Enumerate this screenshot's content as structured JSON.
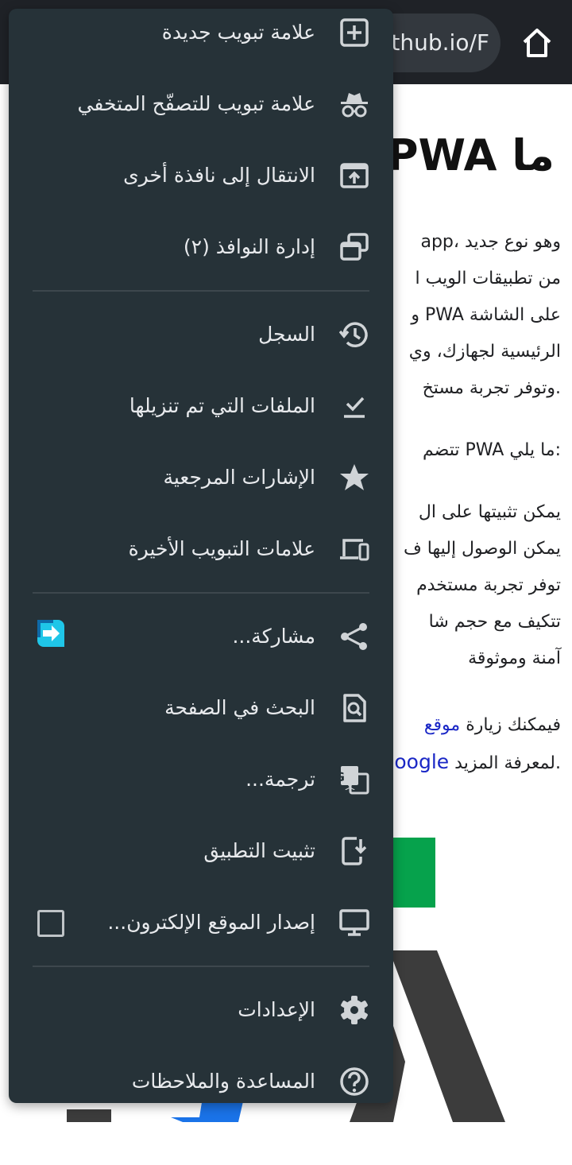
{
  "browser": {
    "url_fragment": "ithub.io/F",
    "home_icon": "home-icon"
  },
  "page": {
    "title": "ما PWA؟",
    "para1": [
      "وهو نوع جديد ،app",
      "من تطبيقات الويب ا",
      "على الشاشة PWA و",
      "الرئيسية لجهازك، وي",
      ".وتوفر تجربة مستخ"
    ],
    "para2": ":ما يلي PWA تتضم",
    "list": [
      "يمكن تثبيتها على ال",
      "يمكن الوصول إليها ف",
      "توفر تجربة مستخدم",
      "تتكيف مع حجم شا",
      "آمنة وموثوقة"
    ],
    "outro_line1_text": "فيمكنك زيارة ",
    "outro_line1_link": "موقع",
    "outro_line2_text": ".لمعرفة المزيد ",
    "outro_line2_link": "oogle",
    "brand_colors": {
      "green": "#06a24c",
      "blue": "#1a73e8",
      "dark": "#3c3c3c"
    }
  },
  "menu": {
    "items": [
      {
        "label": "علامة تبويب جديدة",
        "icon": "new-tab-icon"
      },
      {
        "label": "علامة تبويب للتصفّح المتخفي",
        "icon": "incognito-icon"
      },
      {
        "label": "الانتقال إلى نافذة أخرى",
        "icon": "move-to-window-icon"
      },
      {
        "label": "إدارة النوافذ (٢)",
        "icon": "manage-windows-icon"
      },
      {
        "label": "السجل",
        "icon": "history-icon"
      },
      {
        "label": "الملفات التي تم تنزيلها",
        "icon": "downloads-icon"
      },
      {
        "label": "الإشارات المرجعية",
        "icon": "star-icon"
      },
      {
        "label": "علامات التبويب الأخيرة",
        "icon": "recent-tabs-icon"
      },
      {
        "label": "مشاركة...",
        "icon": "share-icon"
      },
      {
        "label": "البحث في الصفحة",
        "icon": "find-in-page-icon"
      },
      {
        "label": "ترجمة...",
        "icon": "translate-icon"
      },
      {
        "label": "تثبيت التطبيق",
        "icon": "install-app-icon"
      },
      {
        "label": "إصدار الموقع الإلكترون...",
        "icon": "desktop-icon",
        "checked": false
      },
      {
        "label": "الإعدادات",
        "icon": "gear-icon"
      },
      {
        "label": "المساعدة والملاحظات",
        "icon": "help-icon"
      }
    ],
    "colors": {
      "background": "#263238",
      "text": "#e8eaed",
      "icon": "#d0d4d7",
      "divider": "#3d474d"
    }
  }
}
